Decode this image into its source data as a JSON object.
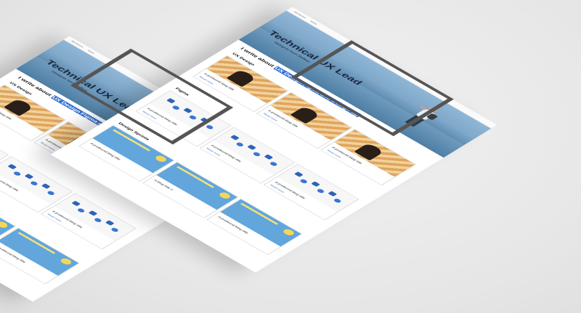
{
  "nav": {
    "items": [
      "Wordpress",
      "Notes"
    ]
  },
  "hero": {
    "title": "Technical UX Lead",
    "subtitle": "Designer from Belfast"
  },
  "tagline": {
    "prefix": "I write about ",
    "topics": [
      "UX Design",
      "Figma",
      "and Design Sp"
    ]
  },
  "sections": [
    {
      "title": "UX Design",
      "cards": [
        {
          "category": "",
          "title": "A profound blog title",
          "link": "Read more"
        },
        {
          "category": "",
          "title": "A profound blog title",
          "link": "Read more"
        },
        {
          "category": "",
          "title": "A profound blog title",
          "link": "Read more"
        }
      ]
    },
    {
      "title": "Figma",
      "cards": [
        {
          "category": "",
          "title": "A profound blog title",
          "link": "Read more"
        },
        {
          "category": "",
          "title": "A profound blog title",
          "link": "Read more"
        },
        {
          "category": "",
          "title": "A profound blog title",
          "link": "Read more"
        }
      ]
    },
    {
      "title": "Design Sprints",
      "cards": [
        {
          "category": "",
          "title": "A profound blog title",
          "link": ""
        },
        {
          "category": "",
          "title": "A blog title 2",
          "link": ""
        },
        {
          "category": "",
          "title": "A profound blog title",
          "link": ""
        }
      ]
    }
  ],
  "colors": {
    "accent": "#2f6fd1",
    "frame": "#555555",
    "background": "#ebebeb"
  }
}
